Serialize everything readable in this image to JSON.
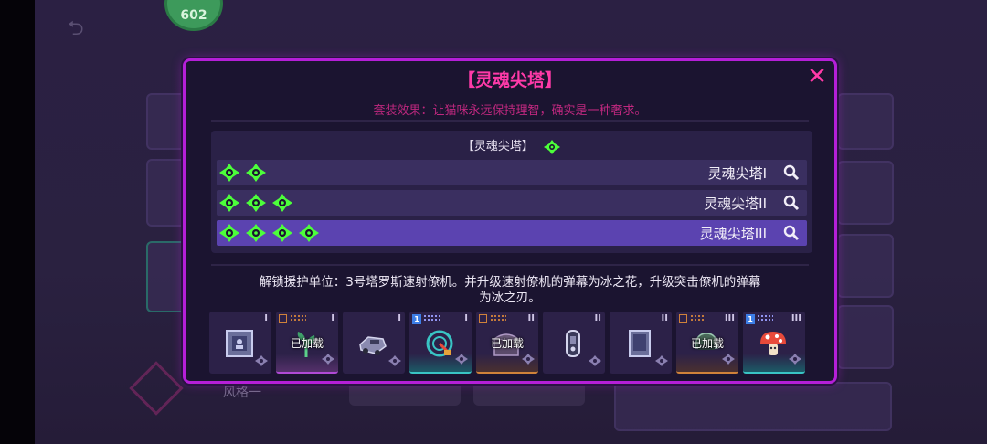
{
  "background": {
    "avatar_badge_text": "602",
    "tab_label": "风格一",
    "colors": {
      "bg": "#2a2140",
      "modal_border": "#b51fd8",
      "accent_pink": "#ff3aa8",
      "gem_green": "#4cff3a",
      "selected_row": "#5b43b0"
    }
  },
  "modal": {
    "title": "【灵魂尖塔】",
    "set_effect": "套装效果：让猫咪永远保持理智，确实是一种奢求。",
    "close_icon": "close-icon",
    "tier_panel": {
      "header": "【灵魂尖塔】",
      "tiers": [
        {
          "name": "灵魂尖塔I",
          "gems": 2,
          "selected": false
        },
        {
          "name": "灵魂尖塔II",
          "gems": 3,
          "selected": false
        },
        {
          "name": "灵魂尖塔III",
          "gems": 4,
          "selected": true
        }
      ]
    },
    "unlock_line1": "解锁援护单位：3号塔罗斯速射僚机。并升级速射僚机的弹幕为冰之花，升级突击僚机的弹幕",
    "unlock_line2": "为冰之刃。",
    "cards": [
      {
        "icon": "frame-cat-icon",
        "tier": "I",
        "loaded": "",
        "badge": "",
        "accent": ""
      },
      {
        "icon": "plant-icon",
        "tier": "I",
        "loaded": "已加载",
        "badge": "book",
        "accent": "purple"
      },
      {
        "icon": "vehicle-icon",
        "tier": "I",
        "loaded": "",
        "badge": "",
        "accent": ""
      },
      {
        "icon": "scanner-icon",
        "tier": "I",
        "loaded": "",
        "badge": "1",
        "accent": "teal"
      },
      {
        "icon": "chest-icon",
        "tier": "II",
        "loaded": "已加载",
        "badge": "book",
        "accent": "orange"
      },
      {
        "icon": "device-icon",
        "tier": "II",
        "loaded": "",
        "badge": "",
        "accent": ""
      },
      {
        "icon": "card-icon",
        "tier": "II",
        "loaded": "",
        "badge": "",
        "accent": ""
      },
      {
        "icon": "helmet-icon",
        "tier": "III",
        "loaded": "已加载",
        "badge": "book",
        "accent": "orange"
      },
      {
        "icon": "mushroom-icon",
        "tier": "III",
        "loaded": "",
        "badge": "1",
        "accent": "teal"
      }
    ]
  }
}
